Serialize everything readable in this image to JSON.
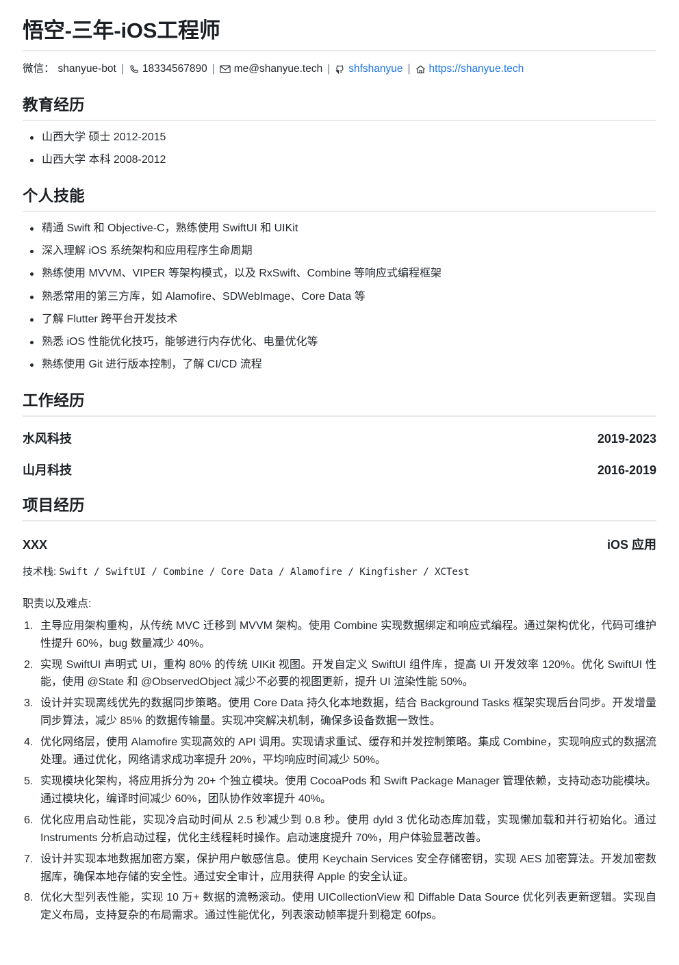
{
  "header": {
    "name_title": "悟空-三年-iOS工程师",
    "contacts": [
      {
        "icon": "wechat-label",
        "label": "微信：",
        "value": "shanyue-bot",
        "link": false
      },
      {
        "icon": "phone-icon",
        "label": "",
        "value": "18334567890",
        "link": false
      },
      {
        "icon": "mail-icon",
        "label": "",
        "value": "me@shanyue.tech",
        "link": false
      },
      {
        "icon": "github-icon",
        "label": "",
        "value": "shfshanyue",
        "link": true
      },
      {
        "icon": "home-icon",
        "label": "",
        "value": "https://shanyue.tech",
        "link": true
      }
    ],
    "separator": "|",
    "link_color": "#1a73e8"
  },
  "sections": {
    "education": {
      "title": "教育经历",
      "items": [
        "山西大学 硕士 2012-2015",
        "山西大学 本科 2008-2012"
      ]
    },
    "skills": {
      "title": "个人技能",
      "items": [
        "精通 Swift 和 Objective-C，熟练使用 SwiftUI 和 UIKit",
        "深入理解 iOS 系统架构和应用程序生命周期",
        "熟练使用 MVVM、VIPER 等架构模式，以及 RxSwift、Combine 等响应式编程框架",
        "熟悉常用的第三方库，如 Alamofire、SDWebImage、Core Data 等",
        "了解 Flutter 跨平台开发技术",
        "熟悉 iOS 性能优化技巧，能够进行内存优化、电量优化等",
        "熟练使用 Git 进行版本控制，了解 CI/CD 流程"
      ]
    },
    "work": {
      "title": "工作经历",
      "items": [
        {
          "company": "水风科技",
          "period": "2019-2023"
        },
        {
          "company": "山月科技",
          "period": "2016-2019"
        }
      ]
    },
    "projects": {
      "title": "项目经历",
      "items": [
        {
          "name": "XXX",
          "category": "iOS 应用",
          "tech_stack_label": "技术栈: ",
          "tech_stack_value": "Swift / SwiftUI / Combine / Core Data / Alamofire / Kingfisher / XCTest",
          "duties_label": "职责以及难点:",
          "duties": [
            "主导应用架构重构，从传统 MVC 迁移到 MVVM 架构。使用 Combine 实现数据绑定和响应式编程。通过架构优化，代码可维护性提升 60%，bug 数量减少 40%。",
            "实现 SwiftUI 声明式 UI，重构 80% 的传统 UIKit 视图。开发自定义 SwiftUI 组件库，提高 UI 开发效率 120%。优化 SwiftUI 性能，使用 @State 和 @ObservedObject 减少不必要的视图更新，提升 UI 渲染性能 50%。",
            "设计并实现离线优先的数据同步策略。使用 Core Data 持久化本地数据，结合 Background Tasks 框架实现后台同步。开发增量同步算法，减少 85% 的数据传输量。实现冲突解决机制，确保多设备数据一致性。",
            "优化网络层，使用 Alamofire 实现高效的 API 调用。实现请求重试、缓存和并发控制策略。集成 Combine，实现响应式的数据流处理。通过优化，网络请求成功率提升 20%，平均响应时间减少 50%。",
            "实现模块化架构，将应用拆分为 20+ 个独立模块。使用 CocoaPods 和 Swift Package Manager 管理依赖，支持动态功能模块。通过模块化，编译时间减少 60%，团队协作效率提升 40%。",
            "优化应用启动性能，实现冷启动时间从 2.5 秒减少到 0.8 秒。使用 dyld 3 优化动态库加载，实现懒加载和并行初始化。通过 Instruments 分析启动过程，优化主线程耗时操作。启动速度提升 70%，用户体验显著改善。",
            "设计并实现本地数据加密方案，保护用户敏感信息。使用 Keychain Services 安全存储密钥，实现 AES 加密算法。开发加密数据库，确保本地存储的安全性。通过安全审计，应用获得 Apple 的安全认证。",
            "优化大型列表性能，实现 10 万+ 数据的流畅滚动。使用 UICollectionView 和 Diffable Data Source 优化列表更新逻辑。实现自定义布局，支持复杂的布局需求。通过性能优化，列表滚动帧率提升到稳定 60fps。"
          ]
        }
      ]
    }
  }
}
